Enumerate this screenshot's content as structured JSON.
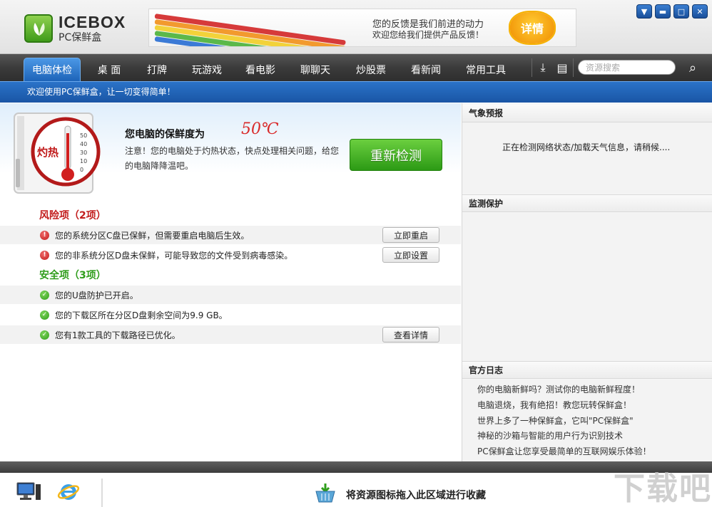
{
  "brand": {
    "name": "ICEBOX",
    "subtitle": "PC保鲜盒"
  },
  "banner": {
    "line1": "您的反馈是我们前进的动力",
    "line2": "欢迎您给我们提供产品反馈！",
    "badge": "详情"
  },
  "window_controls": [
    {
      "icon": "menu-icon",
      "glyph": "▼"
    },
    {
      "icon": "minimize-icon",
      "glyph": "▬"
    },
    {
      "icon": "maximize-icon",
      "glyph": "□"
    },
    {
      "icon": "close-icon",
      "glyph": "✕"
    }
  ],
  "nav": {
    "tabs": [
      "电脑体检",
      "桌 面",
      "打牌",
      "玩游戏",
      "看电影",
      "聊聊天",
      "炒股票",
      "看新闻",
      "常用工具"
    ],
    "active": "电脑体检",
    "search_placeholder": "资源搜索"
  },
  "welcome": "欢迎使用PC保鲜盒，让一切变得简单！",
  "status": {
    "badge": "灼热",
    "title": "您电脑的保鲜度为",
    "temperature": "50℃",
    "description": "注意！您的电脑处于灼热状态，快点处理相关问题，给您的电脑降降温吧。",
    "recheck_label": "重新检测",
    "thermometer_ticks": [
      "50",
      "40",
      "30",
      "10",
      "0"
    ]
  },
  "risk": {
    "title": "风险项（2项）",
    "items": [
      {
        "text": "您的系统分区C盘已保鲜，但需要重启电脑后生效。",
        "action": "立即重启"
      },
      {
        "text": "您的非系统分区D盘未保鲜，可能导致您的文件受到病毒感染。",
        "action": "立即设置"
      }
    ]
  },
  "safe": {
    "title": "安全项（3项）",
    "items": [
      {
        "text": "您的U盘防护已开启。",
        "action": ""
      },
      {
        "text": "您的下载区所在分区D盘剩余空间为9.9 GB。",
        "action": ""
      },
      {
        "text": "您有1款工具的下载路径已优化。",
        "action": "查看详情"
      }
    ]
  },
  "right": {
    "weather": {
      "title": "气象预报",
      "message": "正在检测网络状态/加载天气信息，请稍候...."
    },
    "monitor": {
      "title": "监测保护"
    },
    "log": {
      "title": "官方日志",
      "items": [
        "你的电脑新鲜吗？测试你的电脑新鲜程度！",
        "电脑退烧，我有绝招！教您玩转保鲜盒！",
        "世界上多了一种保鲜盒，它叫\"PC保鲜盒\"",
        "神秘的沙箱与智能的用户行为识别技术",
        "PC保鲜盒让您享受最简单的互联网娱乐体验！"
      ]
    }
  },
  "dock": {
    "drop_hint": "将资源图标拖入此区域进行收藏",
    "watermark": "下载吧"
  },
  "colors": {
    "accent_blue": "#1d63b8",
    "risk_red": "#c21c1c",
    "safe_green": "#2f9d1b",
    "temp_red": "#d92a2a",
    "recheck_green": "#2c9a15"
  }
}
